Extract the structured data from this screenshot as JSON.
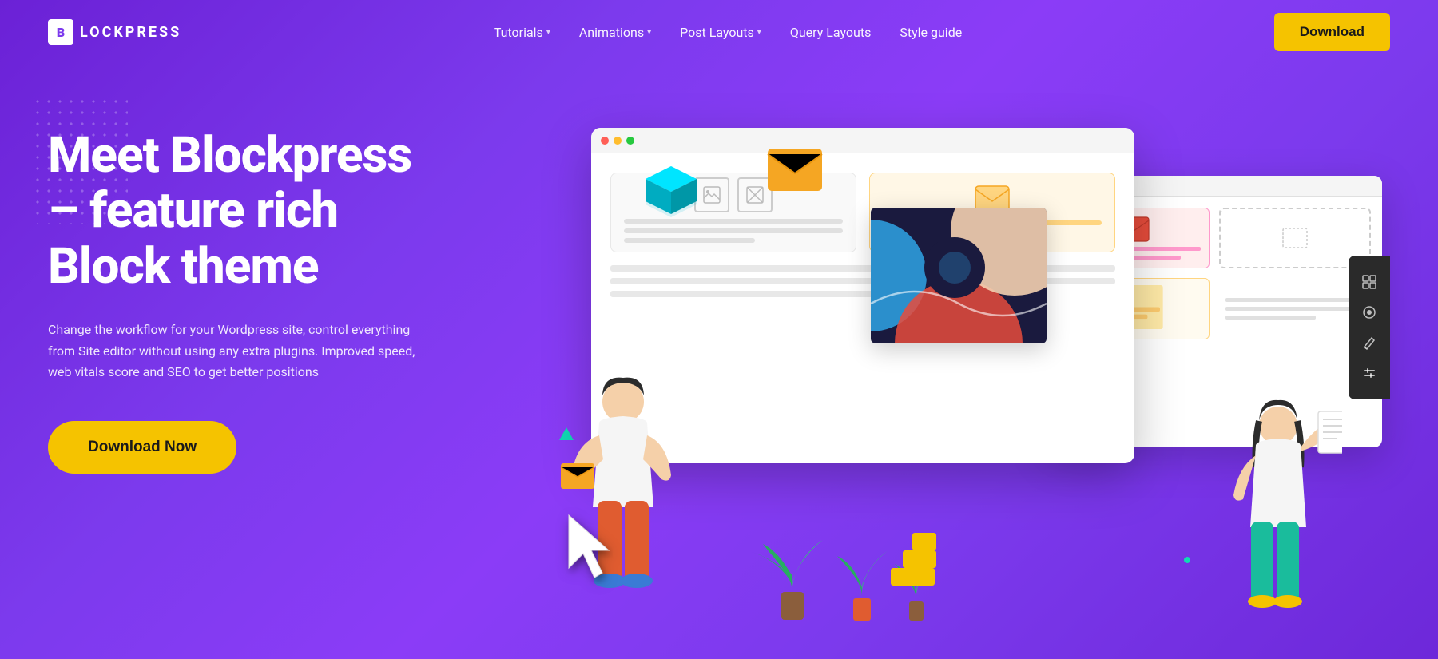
{
  "brand": {
    "logo_letter": "B",
    "logo_text": "LOCKPRESS"
  },
  "nav": {
    "links": [
      {
        "label": "Tutorials",
        "has_dropdown": true
      },
      {
        "label": "Animations",
        "has_dropdown": true
      },
      {
        "label": "Post Layouts",
        "has_dropdown": true
      },
      {
        "label": "Query Layouts",
        "has_dropdown": false
      },
      {
        "label": "Style guide",
        "has_dropdown": false
      }
    ],
    "cta_label": "Download"
  },
  "hero": {
    "title_line1": "Meet Blockpress",
    "title_line2": "– feature rich",
    "title_line3": "Block theme",
    "description": "Change the workflow for your Wordpress site, control everything from Site editor without using any extra plugins. Improved speed, web vitals score and SEO to get better positions",
    "cta_label": "Download Now"
  },
  "colors": {
    "bg_start": "#6b21d6",
    "bg_end": "#8b3cf7",
    "cta_yellow": "#f5c300",
    "accent_teal": "#10d9b4",
    "accent_orange": "#ff6b35"
  }
}
